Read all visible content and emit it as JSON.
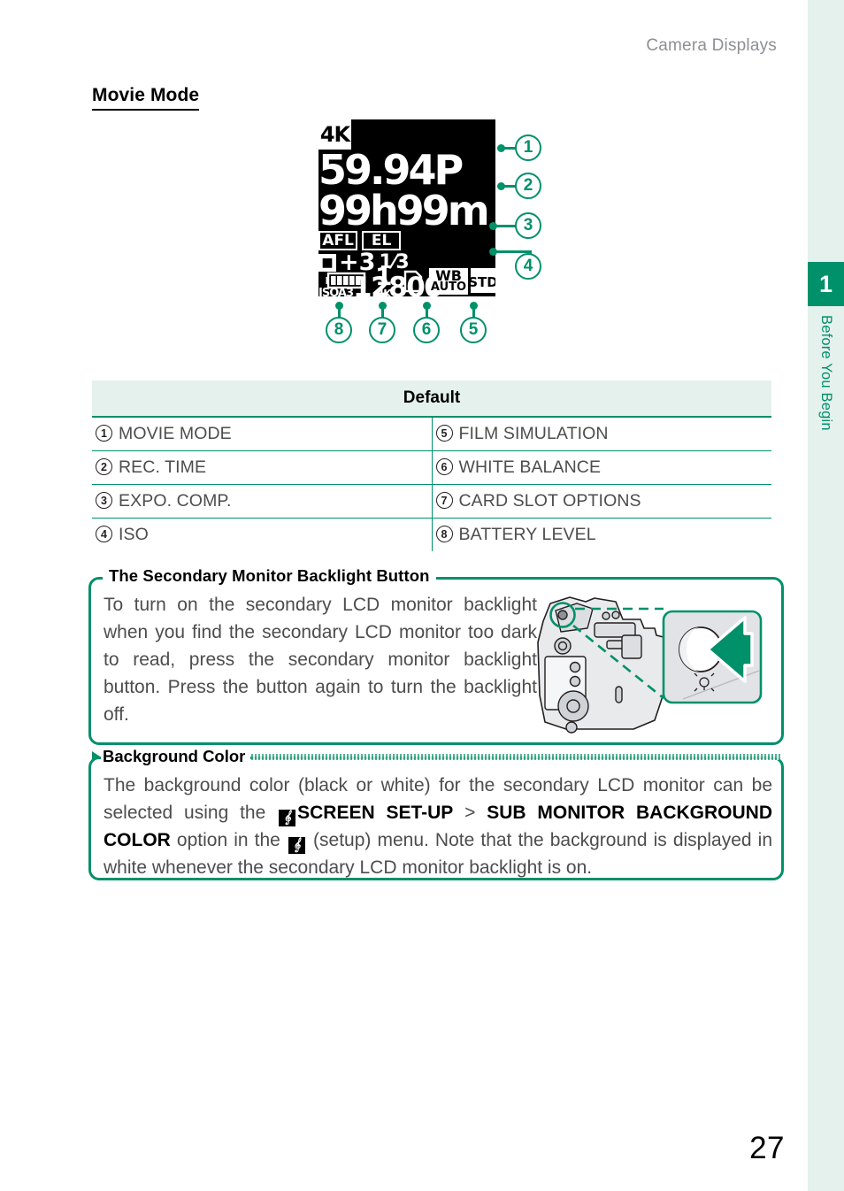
{
  "running_head": "Camera Displays",
  "page_title": "Movie Mode",
  "folio": "27",
  "chapter": {
    "number": "1",
    "label": "Before You Begin"
  },
  "lcd": {
    "quality": "4K",
    "frame_rate": "59.94P",
    "rec_time": "99h99m",
    "af_lock": "AFL",
    "ae_lock": "EL",
    "exposure_comp_icon": "exposure-comp-icon",
    "exposure_comp": "+3",
    "exposure_comp_fraction_num": "1",
    "exposure_comp_fraction_den": "3",
    "iso_tag": "ISOA3",
    "iso_value": "12800",
    "battery_icon": "battery-full-icon",
    "card_slot_number": "1",
    "card_slot_sub": "4K",
    "card_icon": "sd-card-icon",
    "white_balance_line1": "WB",
    "white_balance_line2": "AUTO",
    "film_simulation": "STD"
  },
  "callouts": [
    {
      "n": "1"
    },
    {
      "n": "2"
    },
    {
      "n": "3"
    },
    {
      "n": "4"
    },
    {
      "n": "5"
    },
    {
      "n": "6"
    },
    {
      "n": "7"
    },
    {
      "n": "8"
    }
  ],
  "table": {
    "header": "Default",
    "rows": [
      {
        "ln": "1",
        "llabel": "MOVIE MODE",
        "rn": "5",
        "rlabel": "FILM SIMULATION"
      },
      {
        "ln": "2",
        "llabel": "REC. TIME",
        "rn": "6",
        "rlabel": "WHITE BALANCE"
      },
      {
        "ln": "3",
        "llabel": "EXPO. COMP.",
        "rn": "7",
        "rlabel": "CARD SLOT OPTIONS"
      },
      {
        "ln": "4",
        "llabel": "ISO",
        "rn": "8",
        "rlabel": "BATTERY LEVEL"
      }
    ]
  },
  "note_backlight": {
    "title": "The Secondary Monitor Backlight Button",
    "body": "To turn on the secondary LCD monitor backlight when you find the secondary LCD monitor too dark to read, press the secondary monitor backlight button. Press the button again to turn the backlight off.",
    "figure_name": "camera-backlight-button-illustration"
  },
  "note_background": {
    "title": "Background Color",
    "text_1": "The background color (black or white) for the secondary LCD monitor can be selected using the ",
    "menu_icon_1": "setup-menu-icon",
    "bold_1": "SCREEN SET-UP",
    "sep": " > ",
    "bold_2": "SUB MONITOR BACKGROUND COLOR",
    "text_2": " option in the ",
    "menu_icon_2": "setup-menu-icon",
    "text_3": " (setup) menu. Note that the background is displayed in white whenever the secondary LCD monitor backlight is on."
  },
  "colors": {
    "green": "#00906a",
    "light_green": "#e4f1ec",
    "body_gray": "#4d4d4f",
    "head_gray": "#8d9094"
  }
}
